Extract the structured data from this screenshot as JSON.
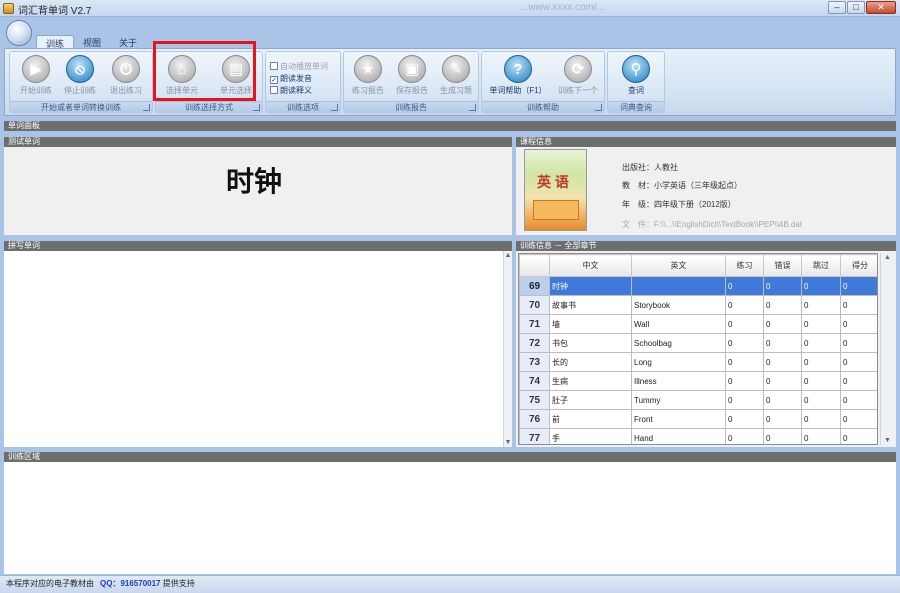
{
  "window": {
    "title": "词汇背单词 V2.7",
    "faded_title": "...www.xxxx.com/...",
    "min": "–",
    "max": "□",
    "close": "✕"
  },
  "ribbon": {
    "tabs": [
      {
        "label": "训练"
      },
      {
        "label": "视图"
      },
      {
        "label": "关于"
      }
    ],
    "groups": {
      "start": {
        "label": "开始或者单词转换训练",
        "buttons": [
          {
            "label": "开始训练",
            "icon": "play-icon"
          },
          {
            "label": "停止训练",
            "icon": "stop-icon"
          },
          {
            "label": "退出练习",
            "icon": "power-icon"
          }
        ]
      },
      "select": {
        "label": "训练选择方式",
        "buttons": [
          {
            "label": "选择单元",
            "icon": "home-icon"
          },
          {
            "label": "单元选择",
            "icon": "book-icon"
          }
        ]
      },
      "options": {
        "label": "训练选项",
        "items": [
          {
            "label": "自动播放单词",
            "checked": false,
            "enabled": false
          },
          {
            "label": "朗读发音",
            "checked": true,
            "enabled": true
          },
          {
            "label": "朗读释义",
            "checked": false,
            "enabled": true
          }
        ]
      },
      "report": {
        "label": "训练报告",
        "buttons": [
          {
            "label": "练习报告",
            "icon": "star-icon"
          },
          {
            "label": "保存报告",
            "icon": "save-icon"
          },
          {
            "label": "生成习题",
            "icon": "pencil-icon"
          }
        ]
      },
      "help": {
        "label": "训练帮助",
        "buttons": [
          {
            "label": "单词帮助（F1）",
            "icon": "question-icon"
          },
          {
            "label": "训练下一个",
            "icon": "next-icon"
          }
        ]
      },
      "query": {
        "label": "词典查询",
        "buttons": [
          {
            "label": "查词",
            "icon": "magnifier-icon"
          }
        ]
      }
    }
  },
  "panels": {
    "main_header": "单词面板",
    "test_word_header": "测试单词",
    "course_info_header": "课程信息",
    "spelling_header": "拼写单词",
    "training_info_header": "训练信息 － 全部章节",
    "training_area_header": "训练区域"
  },
  "test_word": "时钟",
  "course": {
    "book_title": "英 语",
    "publisher": "出版社：人教社",
    "textbook": "教　材：小学英语（三年级起点）",
    "grade": "年　级：四年级下册（2012版）",
    "file": "文　件：F:\\\\...\\\\EnglishDict\\\\TextBook\\\\PEP\\\\4B.dat"
  },
  "table": {
    "columns": [
      "",
      "中文",
      "英文",
      "练习",
      "错误",
      "跳过",
      "得分"
    ],
    "rows": [
      {
        "no": "69",
        "zh": "时钟",
        "en": "",
        "practice": "0",
        "errors": "0",
        "skip": "0",
        "score": "0",
        "selected": true
      },
      {
        "no": "70",
        "zh": "故事书",
        "en": "Storybook",
        "practice": "0",
        "errors": "0",
        "skip": "0",
        "score": "0",
        "selected": false
      },
      {
        "no": "71",
        "zh": "墙",
        "en": "Wall",
        "practice": "0",
        "errors": "0",
        "skip": "0",
        "score": "0",
        "selected": false
      },
      {
        "no": "72",
        "zh": "书包",
        "en": "Schoolbag",
        "practice": "0",
        "errors": "0",
        "skip": "0",
        "score": "0",
        "selected": false
      },
      {
        "no": "73",
        "zh": "长的",
        "en": "Long",
        "practice": "0",
        "errors": "0",
        "skip": "0",
        "score": "0",
        "selected": false
      },
      {
        "no": "74",
        "zh": "生病",
        "en": "Illness",
        "practice": "0",
        "errors": "0",
        "skip": "0",
        "score": "0",
        "selected": false
      },
      {
        "no": "75",
        "zh": "肚子",
        "en": "Tummy",
        "practice": "0",
        "errors": "0",
        "skip": "0",
        "score": "0",
        "selected": false
      },
      {
        "no": "76",
        "zh": "前",
        "en": "Front",
        "practice": "0",
        "errors": "0",
        "skip": "0",
        "score": "0",
        "selected": false
      },
      {
        "no": "77",
        "zh": "手",
        "en": "Hand",
        "practice": "0",
        "errors": "0",
        "skip": "0",
        "score": "0",
        "selected": false
      }
    ]
  },
  "status": {
    "text": "本程序对应的电子教材由",
    "qq": "QQ：916570017",
    "support": "提供支持"
  },
  "colors": {
    "selection": "#3f79d9",
    "highlight_box": "#e8141b",
    "section_header": "#6e6e6e"
  }
}
